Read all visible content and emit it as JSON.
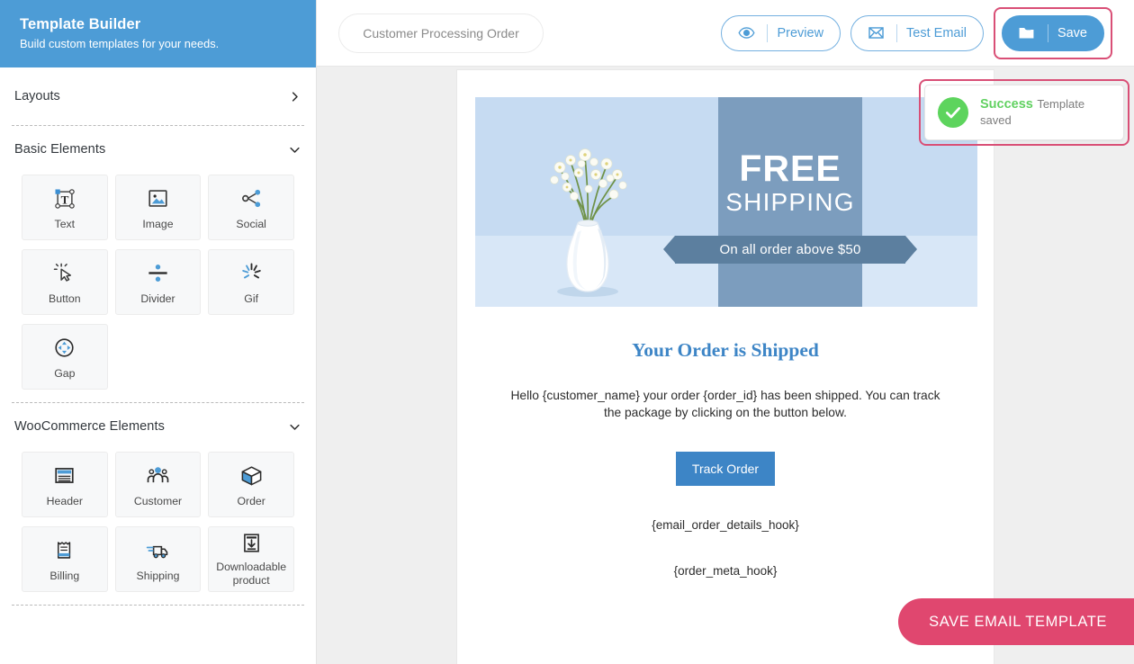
{
  "sidebar": {
    "title": "Template Builder",
    "subtitle": "Build custom templates for your needs.",
    "layouts": {
      "label": "Layouts",
      "icon": "chevron-right-icon"
    },
    "sections": [
      {
        "label": "Basic Elements",
        "icon": "chevron-down-icon",
        "items": [
          {
            "label": "Text",
            "icon": "text-element-icon"
          },
          {
            "label": "Image",
            "icon": "image-element-icon"
          },
          {
            "label": "Social",
            "icon": "social-share-icon"
          },
          {
            "label": "Button",
            "icon": "button-click-icon"
          },
          {
            "label": "Divider",
            "icon": "divider-icon"
          },
          {
            "label": "Gif",
            "icon": "gif-sparkle-icon"
          },
          {
            "label": "Gap",
            "icon": "gap-move-icon"
          }
        ]
      },
      {
        "label": "WooCommerce Elements",
        "icon": "chevron-down-icon",
        "items": [
          {
            "label": "Header",
            "icon": "header-icon"
          },
          {
            "label": "Customer",
            "icon": "customer-group-icon"
          },
          {
            "label": "Order",
            "icon": "order-box-icon"
          },
          {
            "label": "Billing",
            "icon": "billing-receipt-icon"
          },
          {
            "label": "Shipping",
            "icon": "shipping-truck-icon"
          },
          {
            "label": "Downloadable product",
            "icon": "download-box-icon"
          }
        ]
      }
    ]
  },
  "topbar": {
    "template_name_value": "",
    "template_name_placeholder": "Customer Processing Order",
    "preview_label": "Preview",
    "preview_icon": "eye-icon",
    "test_email_label": "Test Email",
    "test_email_icon": "envelope-icon",
    "save_label": "Save",
    "save_icon": "folder-icon",
    "save_highlight_color": "#d94f76",
    "accent_color": "#4d9cd6"
  },
  "toast": {
    "title": "Success",
    "message": "Template saved",
    "icon": "check-circle-icon",
    "title_color": "#61d161",
    "highlight_color": "#d94f76"
  },
  "email": {
    "banner": {
      "headline": "FREE",
      "subhead": "SHIPPING",
      "ribbon": "On all order above $50",
      "alt": "white-vase-with-flowers-photo",
      "bg_color": "#c6dbf2",
      "panel_color": "#7c9dbe",
      "ribbon_color": "#5c7f9f"
    },
    "title": "Your Order is Shipped",
    "title_color": "#3d85c6",
    "body": "Hello {customer_name} your order {order_id} has been shipped. You can track the package by clicking on the button below.",
    "cta_label": "Track Order",
    "cta_color": "#3d85c6",
    "hook_order_details": "{email_order_details_hook}",
    "hook_order_meta": "{order_meta_hook}"
  },
  "fab": {
    "label": "SAVE EMAIL TEMPLATE",
    "color": "#e0476f"
  }
}
